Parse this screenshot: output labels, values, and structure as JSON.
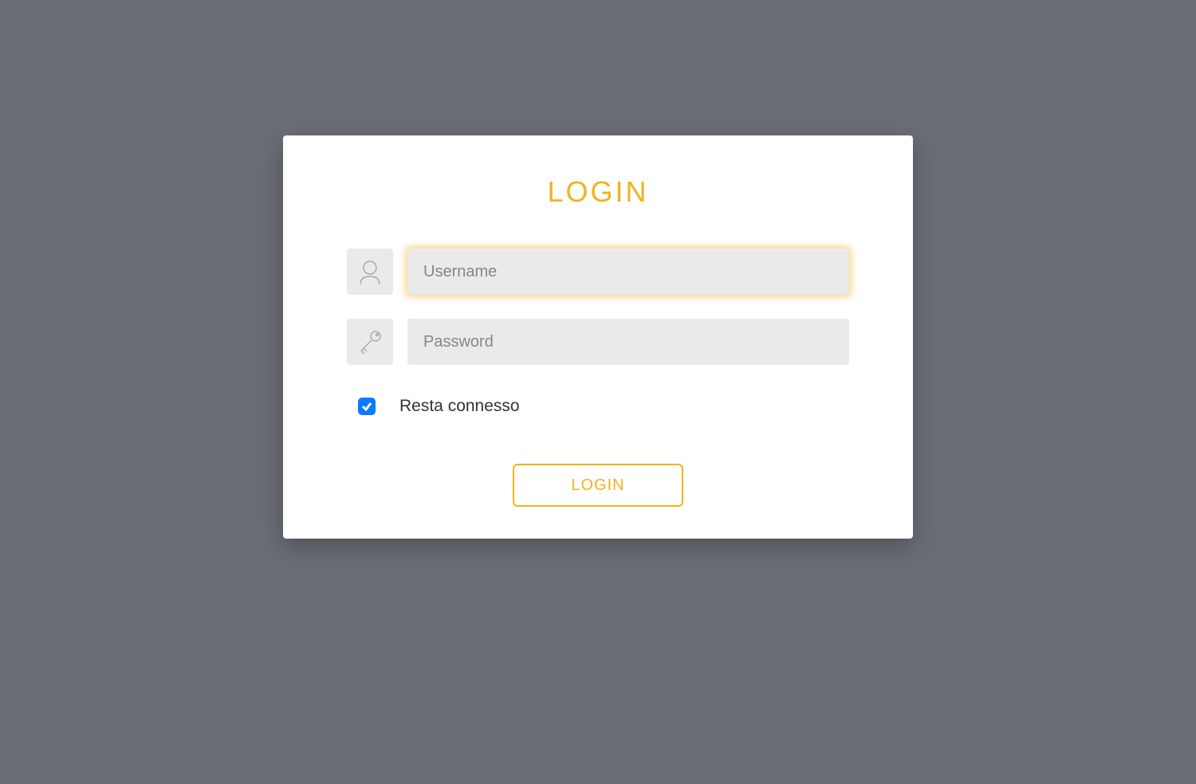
{
  "colors": {
    "accent": "#f3b21b",
    "background": "#6a6d74",
    "checkbox": "#0a7aff"
  },
  "login": {
    "title": "LOGIN",
    "username": {
      "placeholder": "Username",
      "value": ""
    },
    "password": {
      "placeholder": "Password",
      "value": ""
    },
    "remember": {
      "label": "Resta connesso",
      "checked": true
    },
    "submit_label": "LOGIN"
  }
}
